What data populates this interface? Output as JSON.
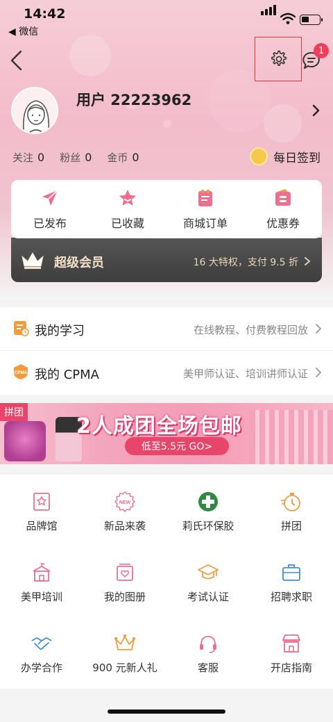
{
  "status_bar": {
    "time": "14:42",
    "back_app": "◀ 微信"
  },
  "header": {
    "message_badge": "1"
  },
  "profile": {
    "username": "用户 22223962",
    "stats": [
      {
        "label": "关注",
        "value": "0"
      },
      {
        "label": "粉丝",
        "value": "0"
      },
      {
        "label": "金币",
        "value": "0"
      }
    ],
    "checkin_label": "每日签到"
  },
  "order_card": {
    "items": [
      {
        "label": "已发布",
        "icon": "send-icon"
      },
      {
        "label": "已收藏",
        "icon": "star-icon"
      },
      {
        "label": "商城订单",
        "icon": "order-icon"
      },
      {
        "label": "优惠券",
        "icon": "coupon-icon"
      }
    ]
  },
  "vip": {
    "title": "超级会员",
    "desc": "16 大特权，支付 9.5 折"
  },
  "list": [
    {
      "title": "我的学习",
      "desc": "在线教程、付费教程回放",
      "icon": "study-icon"
    },
    {
      "title": "我的 CPMA",
      "desc": "美甲师认证、培训讲师认证",
      "icon": "cpma-icon",
      "icon_text": "CPMA"
    }
  ],
  "banner": {
    "tag": "拼团",
    "headline": "2人成团全场包邮",
    "cta": "低至5.5元 GO>"
  },
  "grid": [
    {
      "label": "品牌馆",
      "icon": "brand-hall-icon"
    },
    {
      "label": "新品来袭",
      "icon": "new-badge-icon",
      "icon_text": "NEW"
    },
    {
      "label": "莉氏环保胶",
      "icon": "plus-cross-icon"
    },
    {
      "label": "拼团",
      "icon": "stopwatch-icon"
    },
    {
      "label": "美甲培训",
      "icon": "school-icon"
    },
    {
      "label": "我的图册",
      "icon": "album-icon"
    },
    {
      "label": "考试认证",
      "icon": "graduation-cap-icon"
    },
    {
      "label": "招聘求职",
      "icon": "briefcase-icon"
    },
    {
      "label": "办学合作",
      "icon": "handshake-icon"
    },
    {
      "label": "900 元新人礼",
      "icon": "crown-icon"
    },
    {
      "label": "客服",
      "icon": "headset-icon"
    },
    {
      "label": "开店指南",
      "icon": "shop-icon"
    }
  ],
  "colors": {
    "accent": "#ef3f5c",
    "pink_icon": "#ec6f8d",
    "orange_icon": "#f39b3d",
    "vip_gold": "#f3e0c6"
  }
}
